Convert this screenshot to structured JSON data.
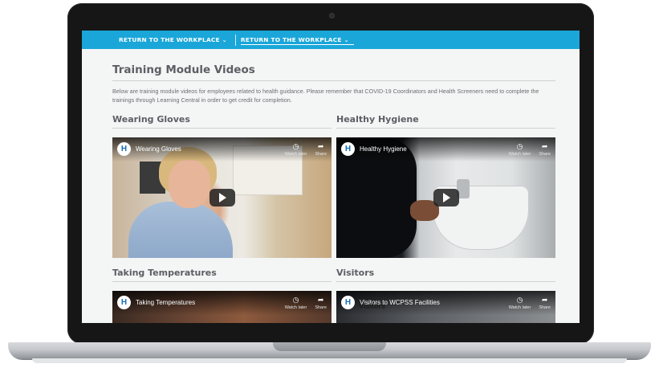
{
  "nav": {
    "items": [
      {
        "label": "RETURN TO THE WORKPLACE",
        "chevron": "⌄",
        "active": false
      },
      {
        "label": "RETURN TO THE WORKPLACE",
        "chevron": "⌄",
        "active": true
      }
    ]
  },
  "page": {
    "title": "Training Module Videos",
    "intro": "Below are training module videos for employees related to health guidance. Please remember that COVID-19 Coordinators and Health Screeners need to complete the trainings through Learning Central in order to get credit for completion."
  },
  "videos": [
    {
      "heading": "Wearing Gloves",
      "title": "Wearing Gloves",
      "watch_later": "Watch later",
      "share": "Share"
    },
    {
      "heading": "Healthy Hygiene",
      "title": "Healthy Hygiene",
      "watch_later": "Watch later",
      "share": "Share"
    },
    {
      "heading": "Taking Temperatures",
      "title": "Taking Temperatures",
      "watch_later": "Watch later",
      "share": "Share"
    },
    {
      "heading": "Visitors",
      "title": "Visitors to WCPSS Facilities",
      "watch_later": "Watch later",
      "share": "Share",
      "overlay": "Visitors"
    }
  ],
  "icons": {
    "channel": "channel-logo-icon",
    "clock": "clock-icon",
    "share": "share-arrow-icon",
    "play": "play-icon"
  },
  "colors": {
    "nav_bg": "#1aa6d9",
    "heading": "#5b5f63",
    "page_bg": "#f4f5f5"
  }
}
